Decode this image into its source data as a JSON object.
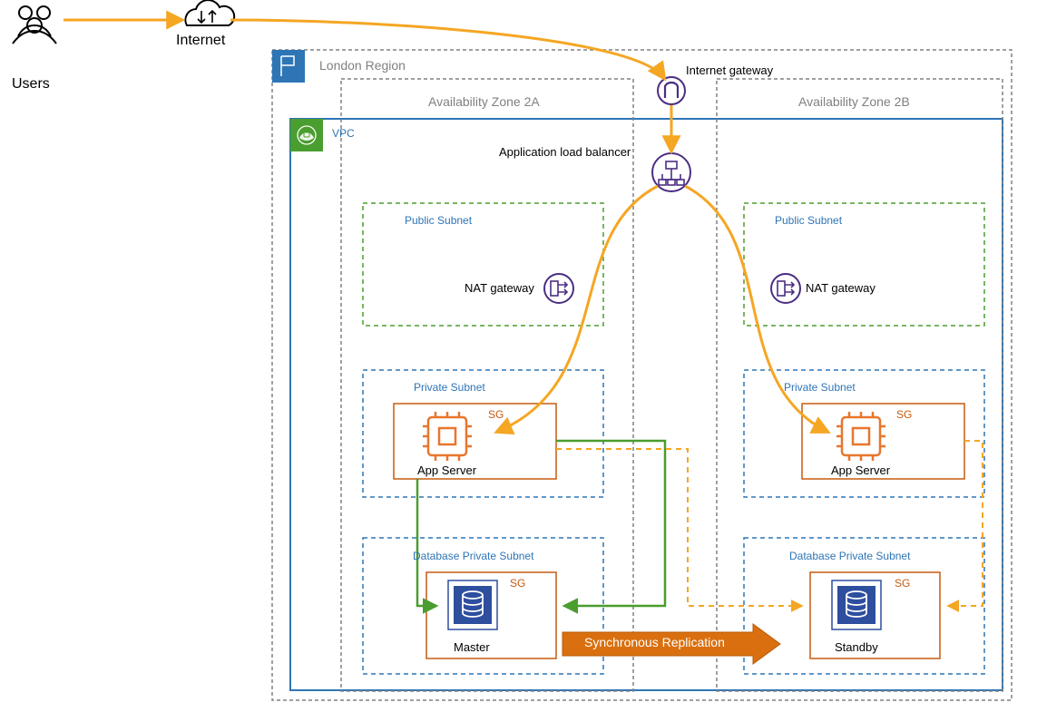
{
  "users": "Users",
  "internet": "Internet",
  "region": "London Region",
  "igw": "Internet gateway",
  "vpc": "VPC",
  "az2a": "Availability Zone 2A",
  "az2b": "Availability Zone 2B",
  "alb": "Application load balancer",
  "public_subnet": "Public Subnet",
  "nat_gateway": "NAT gateway",
  "private_subnet": "Private Subnet",
  "sg": "SG",
  "app_server": "App Server",
  "db_private_subnet": "Database Private Subnet",
  "master": "Master",
  "standby": "Standby",
  "sync_repl": "Synchronous Replication"
}
